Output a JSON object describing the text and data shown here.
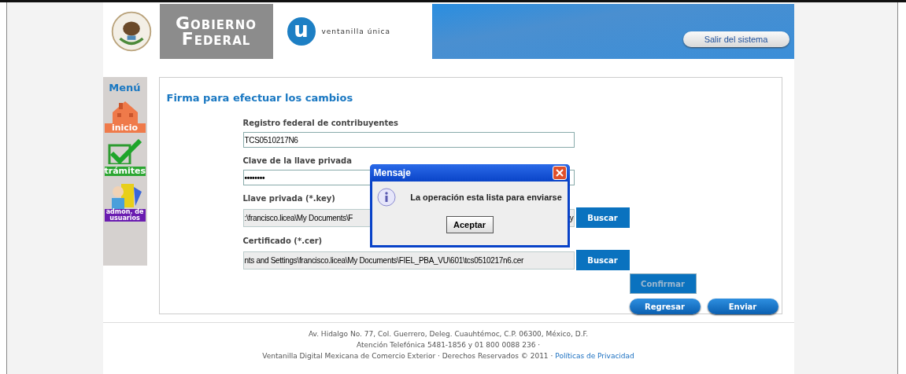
{
  "header": {
    "brand_line_1": "Gobierno",
    "brand_line_2": "Federal",
    "logo_letter": "u",
    "logo_text": "ventanilla única",
    "logout_button": "Salir del sistema"
  },
  "menu": {
    "title": "Menú",
    "items": [
      {
        "kind": "home",
        "label": "inicio"
      },
      {
        "kind": "check",
        "label": "trámites"
      },
      {
        "kind": "users",
        "label": "admon. de usuarios"
      }
    ]
  },
  "form": {
    "title": "Firma para efectuar los cambios",
    "fields": [
      {
        "kind": "text",
        "label": "Registro federal de contribuyentes",
        "value": "TCS0510217N6"
      },
      {
        "kind": "password",
        "label": "Clave de la llave privada",
        "value": "••••••••"
      },
      {
        "kind": "file",
        "label": "Llave privada (*.key)",
        "value": ":\\francisco.licea\\My Documents\\F",
        "value_end": "y",
        "button": "Buscar"
      },
      {
        "kind": "file",
        "label": "Certificado (*.cer)",
        "value": "nts and Settings\\francisco.licea\\My Documents\\FIEL_PBA_VU\\601\\tcs0510217n6.cer",
        "button": "Buscar"
      }
    ],
    "confirm_button": {
      "label": "Confirmar",
      "disabled": true
    },
    "buttons": [
      "Regresar",
      "Enviar"
    ]
  },
  "dialog": {
    "title": "Mensaje",
    "message": "La operación esta lista para enviarse",
    "button": "Aceptar"
  },
  "footer": {
    "lines": [
      "Av. Hidalgo No. 77, Col. Guerrero, Deleg. Cuauhtémoc, C.P. 06300, México, D.F.",
      "Atención Telefónica 5481-1856 y 01 800 0088 236 ·"
    ],
    "rights": "Ventanilla Digital Mexicana de Comercio Exterior · Derechos Reservados © 2011 ·",
    "privacy_link": "Políticas de Privacidad"
  }
}
